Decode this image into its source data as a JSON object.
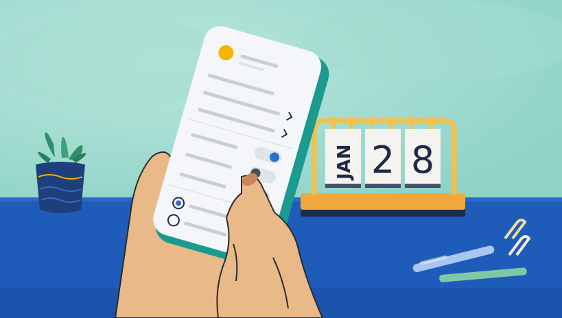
{
  "calendar": {
    "month": "JAN",
    "day_tens": "2",
    "day_ones": "8"
  },
  "colors": {
    "wall": "#8fd3c7",
    "wall_light": "#b9e6dc",
    "desk": "#1f5bb8",
    "desk_dark": "#173f8a",
    "phone_case": "#1b9a8f",
    "phone_screen": "#f4f6fa",
    "accent_yellow": "#f5b400",
    "toggle_blue": "#2a6fd1",
    "skin": "#e9b987",
    "calendar_base": "#f0a83a",
    "calendar_frame": "#f3c14b",
    "calendar_card": "#f5f3ef",
    "plant_pot": "#1e3f7a",
    "plant_leaf": "#2f8f6a",
    "pen_light": "#a9c6f0",
    "pen_green": "#7fc8a6",
    "clip": "#f0dca0"
  },
  "icons": {
    "chevron": "chevron-right-icon",
    "avatar": "avatar-dot",
    "radio": "radio-icon",
    "toggle": "toggle-switch"
  }
}
